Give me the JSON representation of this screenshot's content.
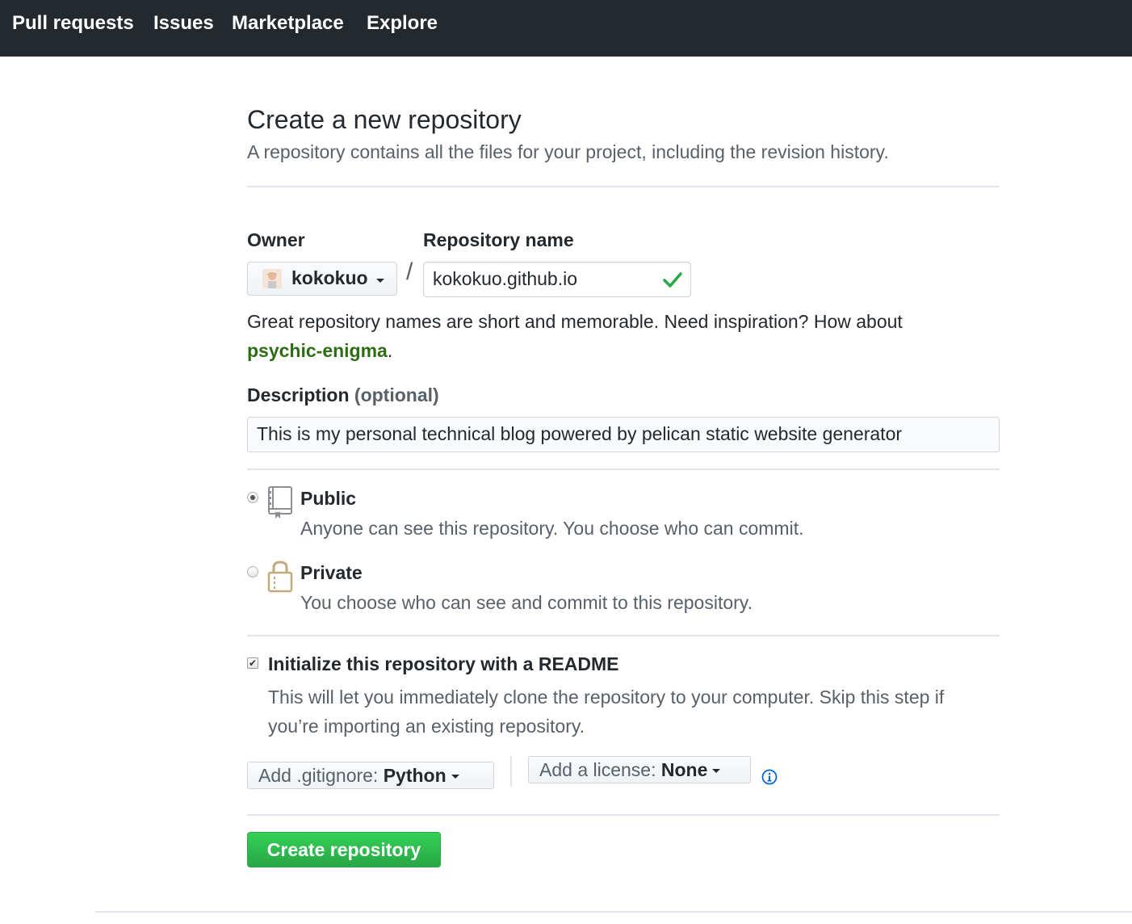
{
  "nav": {
    "items": [
      "Pull requests",
      "Issues",
      "Marketplace",
      "Explore"
    ]
  },
  "header": {
    "title": "Create a new repository",
    "subtitle": "A repository contains all the files for your project, including the revision history."
  },
  "form": {
    "owner_label": "Owner",
    "owner_value": "kokokuo",
    "slash": "/",
    "repo_label": "Repository name",
    "repo_value": "kokokuo.github.io",
    "hint_text": "Great repository names are short and memorable. Need inspiration? How about",
    "hint_suggestion": "psychic-enigma",
    "hint_end": ".",
    "description_label": "Description",
    "description_optional": "(optional)",
    "description_value": "This is my personal technical blog powered by pelican static website generator",
    "visibility": {
      "public_title": "Public",
      "public_desc": "Anyone can see this repository. You choose who can commit.",
      "private_title": "Private",
      "private_desc": "You choose who can see and commit to this repository.",
      "selected": "public"
    },
    "readme": {
      "checked": true,
      "title": "Initialize this repository with a README",
      "desc": "This will let you immediately clone the repository to your computer. Skip this step if you’re importing an existing repository."
    },
    "gitignore": {
      "label": "Add .gitignore:",
      "value": "Python"
    },
    "license": {
      "label": "Add a license:",
      "value": "None"
    },
    "submit_label": "Create repository"
  },
  "colors": {
    "nav_bg": "#24292e",
    "accent_green": "#28a745",
    "suggestion_green": "#2c6d14",
    "muted_text": "#586069",
    "border": "#e1e4e8"
  }
}
